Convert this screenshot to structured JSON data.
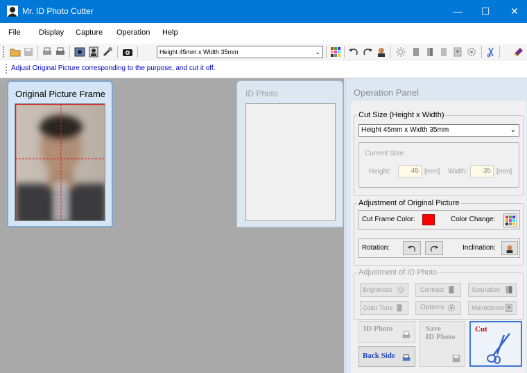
{
  "window": {
    "title": "Mr. ID Photo Cutter"
  },
  "menu": [
    "File",
    "Display",
    "Capture",
    "Operation",
    "Help"
  ],
  "toolbar": {
    "size_value": "Height 45mm x Width 35mm"
  },
  "hint": "Adjust Original Picture corresponding to the purpose, and cut it off.",
  "original_frame": {
    "title": "Original Picture Frame"
  },
  "id_photo": {
    "title": "ID Photo"
  },
  "operation": {
    "title": "Operation Panel",
    "cut_size": {
      "label": "Cut Size (Height x Width)",
      "value": "Height 45mm x Width 35mm",
      "current_size_label": "Current Size:",
      "height_label": "Height:",
      "height_value": "45",
      "width_label": "Width:",
      "width_value": "35",
      "unit": "[mm]"
    },
    "adjust_original": {
      "label": "Adjustment of Original Picture",
      "cut_frame_color_label": "Cut Frame Color:",
      "cut_frame_color": "#ff0000",
      "color_change_label": "Color Change:",
      "rotation_label": "Rotation:",
      "inclination_label": "Inclination:"
    },
    "adjust_id": {
      "label": "Adjustment of ID Photo",
      "brightness": "Brightness",
      "contrast": "Contrast",
      "saturation": "Saturation",
      "color_tone": "Color Tone",
      "options": "Options",
      "monochrome": "Monochrom"
    },
    "buttons": {
      "id_photo": "ID Photo",
      "save_line1": "Save",
      "save_line2": "ID Photo",
      "cut": "Cut",
      "back_side": "Back Side"
    }
  }
}
